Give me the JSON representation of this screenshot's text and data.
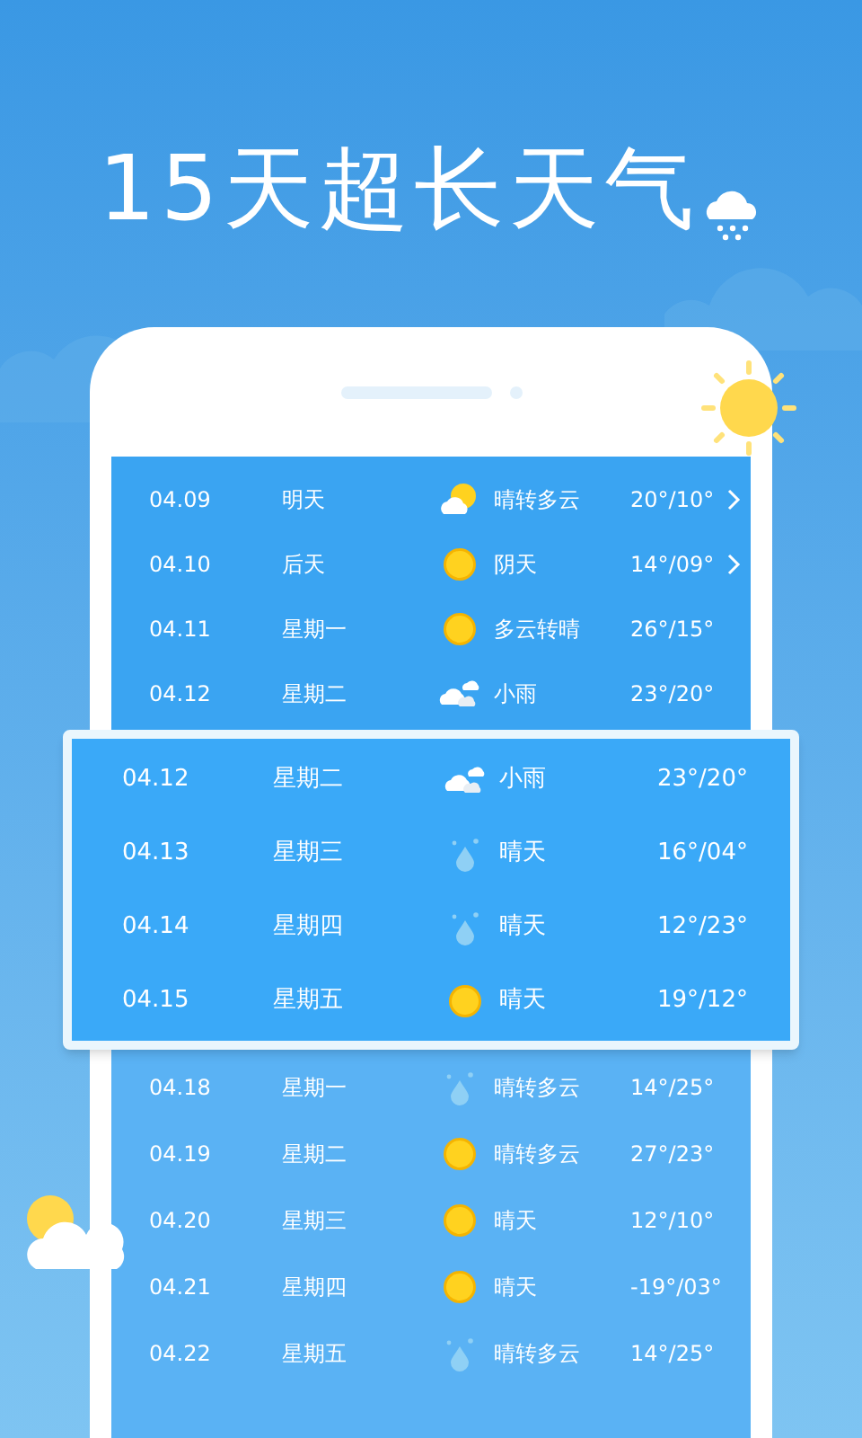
{
  "title": "15天超长天气",
  "top_list": {
    "rows": [
      {
        "date": "04.09",
        "day": "明天",
        "kind": "cloud-sun",
        "condition": "晴转多云",
        "temp": "20°/10°",
        "arrow": true
      },
      {
        "date": "04.10",
        "day": "后天",
        "kind": "sun",
        "condition": "阴天",
        "temp": "14°/09°",
        "arrow": true
      },
      {
        "date": "04.11",
        "day": "星期一",
        "kind": "sun",
        "condition": "多云转晴",
        "temp": "26°/15°",
        "arrow": false
      },
      {
        "date": "04.12",
        "day": "星期二",
        "kind": "clouds",
        "condition": "小雨",
        "temp": "23°/20°",
        "arrow": false
      }
    ]
  },
  "highlight_card": {
    "rows": [
      {
        "date": "04.12",
        "day": "星期二",
        "kind": "clouds",
        "condition": "小雨",
        "temp": "23°/20°"
      },
      {
        "date": "04.13",
        "day": "星期三",
        "kind": "drops",
        "condition": "晴天",
        "temp": "16°/04°"
      },
      {
        "date": "04.14",
        "day": "星期四",
        "kind": "drops",
        "condition": "晴天",
        "temp": "12°/23°"
      },
      {
        "date": "04.15",
        "day": "星期五",
        "kind": "sun",
        "condition": "晴天",
        "temp": "19°/12°"
      }
    ]
  },
  "bottom_list": {
    "rows": [
      {
        "date": "04.18",
        "day": "星期一",
        "kind": "drops",
        "condition": "晴转多云",
        "temp": "14°/25°"
      },
      {
        "date": "04.19",
        "day": "星期二",
        "kind": "sun",
        "condition": "晴转多云",
        "temp": "27°/23°"
      },
      {
        "date": "04.20",
        "day": "星期三",
        "kind": "sun",
        "condition": "晴天",
        "temp": "12°/10°"
      },
      {
        "date": "04.21",
        "day": "星期四",
        "kind": "sun",
        "condition": "晴天",
        "temp": "-19°/03°"
      },
      {
        "date": "04.22",
        "day": "星期五",
        "kind": "drops",
        "condition": "晴转多云",
        "temp": "14°/25°"
      }
    ]
  }
}
